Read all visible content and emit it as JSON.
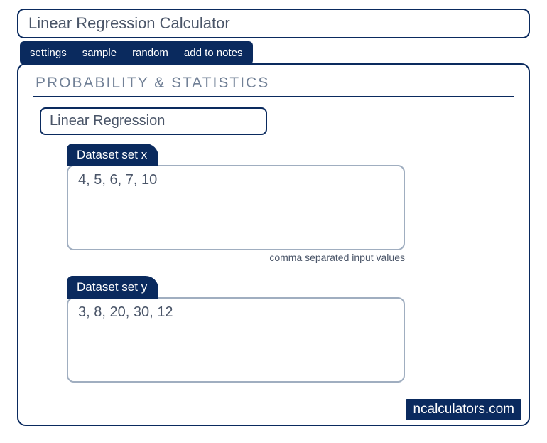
{
  "header": {
    "title": "Linear Regression Calculator"
  },
  "tabs": {
    "settings": "settings",
    "sample": "sample",
    "random": "random",
    "add_to_notes": "add to notes"
  },
  "section": {
    "heading": "PROBABILITY & STATISTICS",
    "subtitle": "Linear Regression"
  },
  "datasets": {
    "x": {
      "label": "Dataset set x",
      "value": "4, 5, 6, 7, 10",
      "hint": "comma separated input values"
    },
    "y": {
      "label": "Dataset set y",
      "value": "3, 8, 20, 30, 12"
    }
  },
  "brand": "ncalculators.com"
}
